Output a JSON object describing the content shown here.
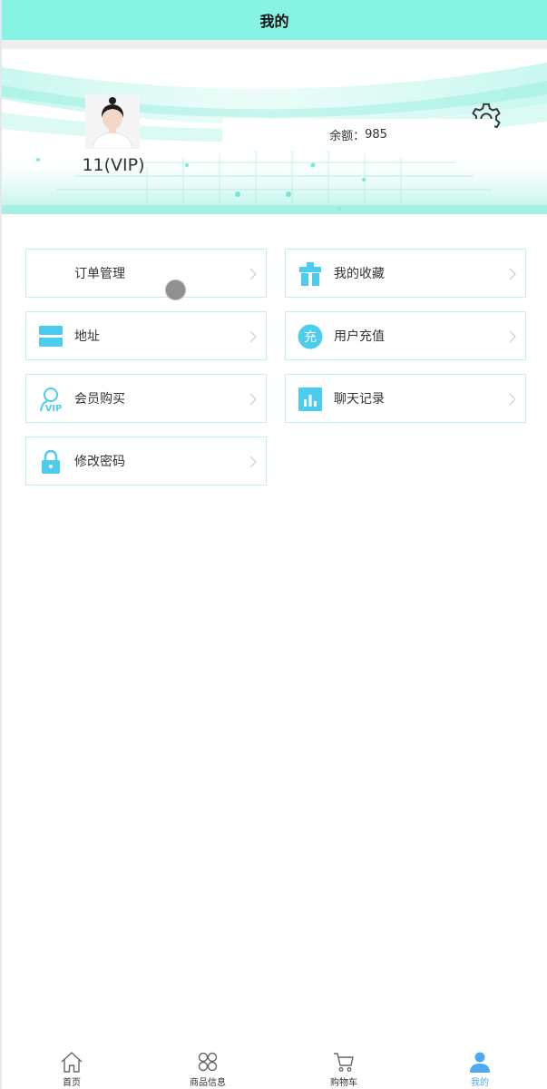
{
  "header": {
    "title": "我的"
  },
  "profile": {
    "username": "11(VIP)",
    "balance_label": "余额：",
    "balance_value": "985"
  },
  "menu": {
    "items": [
      {
        "label": "订单管理",
        "icon": "order-icon"
      },
      {
        "label": "我的收藏",
        "icon": "favorites-icon"
      },
      {
        "label": "地址",
        "icon": "address-icon"
      },
      {
        "label": "用户充值",
        "icon": "recharge-icon",
        "icon_text": "充"
      },
      {
        "label": "会员购买",
        "icon": "vip-icon",
        "icon_text": "VIP"
      },
      {
        "label": "聊天记录",
        "icon": "chart-icon"
      },
      {
        "label": "修改密码",
        "icon": "lock-icon"
      }
    ]
  },
  "tabbar": {
    "tabs": [
      {
        "label": "首页",
        "icon": "home-icon"
      },
      {
        "label": "商品信息",
        "icon": "grid-icon"
      },
      {
        "label": "购物车",
        "icon": "cart-icon"
      },
      {
        "label": "我的",
        "icon": "user-icon",
        "active": true
      }
    ]
  },
  "colors": {
    "navbar": "#87f3e3",
    "accent": "#4ccdee",
    "tab_active": "#4fa8f0",
    "card_border": "#c9ecf3"
  }
}
